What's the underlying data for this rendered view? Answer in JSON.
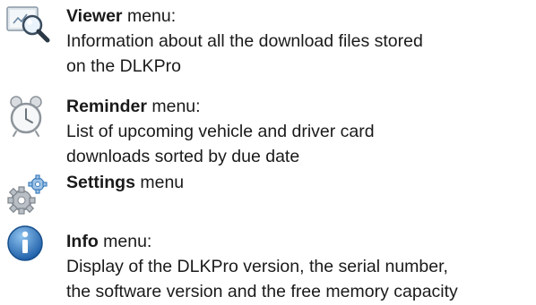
{
  "items": [
    {
      "icon": "viewer-magnifier-icon",
      "title": "Viewer",
      "suffix": " menu:",
      "lines": [
        "Information about all the download files stored",
        "on the DLKPro"
      ]
    },
    {
      "icon": "alarm-clock-icon",
      "title": "Reminder",
      "suffix": " menu:",
      "lines": [
        "List of upcoming vehicle and driver card",
        "downloads sorted by due date"
      ]
    },
    {
      "icon": "gears-icon",
      "title": "Settings",
      "suffix": " menu",
      "lines": []
    },
    {
      "icon": "info-icon",
      "title": "Info",
      "suffix": " menu:",
      "lines": [
        "Display of the DLKPro version, the serial number,",
        "the software version and the free memory capacity"
      ]
    }
  ]
}
